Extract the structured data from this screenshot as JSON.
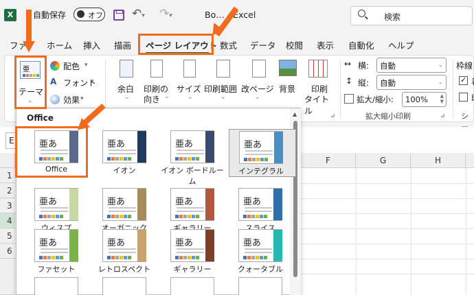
{
  "titlebar": {
    "autosave_label": "自動保存",
    "autosave_state": "オフ",
    "doc_title": "Bo… - Excel",
    "search_placeholder": "検索"
  },
  "tabs": [
    {
      "label": "ファ"
    },
    {
      "label": "ホーム"
    },
    {
      "label": "挿入"
    },
    {
      "label": "描画"
    },
    {
      "label": "ページ レイアウト",
      "active": true
    },
    {
      "label": "数式"
    },
    {
      "label": "データ"
    },
    {
      "label": "校閲"
    },
    {
      "label": "表示"
    },
    {
      "label": "自動化"
    },
    {
      "label": "ヘルプ"
    }
  ],
  "ribbon": {
    "theme_button": "テーマ",
    "colors": "配色",
    "fonts": "フォント",
    "effects": "効果",
    "margins": "余白",
    "orientation_l1": "印刷の",
    "orientation_l2": "向き",
    "size": "サイズ",
    "print_area": "印刷範囲",
    "breaks": "改ページ",
    "background": "背景",
    "print_titles_l1": "印刷",
    "print_titles_l2": "タイトル",
    "width_label": "横:",
    "width_value": "自動",
    "height_label": "縦:",
    "height_value": "自動",
    "scale_label": "拡大/縮小:",
    "scale_value": "100%",
    "group_scale_label": "拡大縮小印刷",
    "gridlines_label": "枠線",
    "gridlines_item1": "表",
    "gridlines_item2": "印",
    "sheet_options_label": "シー"
  },
  "sheet": {
    "columns": [
      "F",
      "G",
      "H"
    ],
    "rows": [
      "1",
      "2",
      "3",
      "4",
      "5",
      "6"
    ],
    "name_box": "E"
  },
  "gallery": {
    "header": "Office",
    "sample_text": "亜あ",
    "themes": [
      {
        "name": "Office",
        "accent": "#5b6a8a",
        "selected": true
      },
      {
        "name": "イオン",
        "accent": "#1f3a5f"
      },
      {
        "name": "イオン ボードルーム",
        "accent": "#394b6e"
      },
      {
        "name": "インテグラル",
        "accent": "#4a8fbf"
      },
      {
        "name": "ウィスプ",
        "accent": "#c8d9a3"
      },
      {
        "name": "オーガニック",
        "accent": "#a88b5f"
      },
      {
        "name": "ギャラリー",
        "accent": "#b5573c"
      },
      {
        "name": "スライス",
        "accent": "#2d6fa8"
      },
      {
        "name": "ファセット",
        "accent": "#7bb349"
      },
      {
        "name": "レトロスペクト",
        "accent": "#c9a36b"
      },
      {
        "name": "ギャラリー",
        "accent": "#7b3f2c"
      },
      {
        "name": "クォータブル",
        "accent": "#2ab8b0"
      }
    ]
  }
}
